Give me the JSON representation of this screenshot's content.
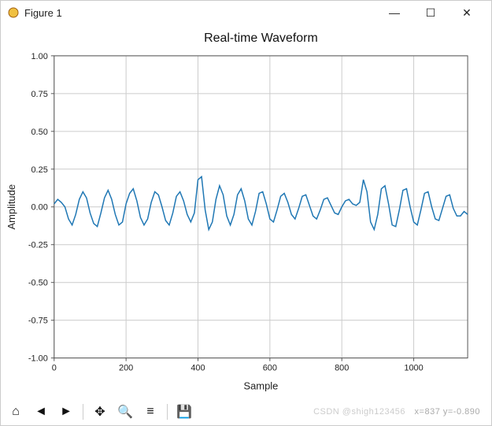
{
  "window": {
    "title": "Figure 1",
    "buttons": {
      "min": "—",
      "max": "☐",
      "close": "✕"
    }
  },
  "chart_data": {
    "type": "line",
    "title": "Real-time Waveform",
    "xlabel": "Sample",
    "ylabel": "Amplitude",
    "xlim": [
      0,
      1150
    ],
    "ylim": [
      -1.0,
      1.0
    ],
    "xticks": [
      0,
      200,
      400,
      600,
      800,
      1000
    ],
    "yticks": [
      -1.0,
      -0.75,
      -0.5,
      -0.25,
      0.0,
      0.25,
      0.5,
      0.75,
      1.0
    ],
    "x_step": 10,
    "values": [
      0.02,
      0.05,
      0.03,
      0.0,
      -0.08,
      -0.12,
      -0.05,
      0.05,
      0.1,
      0.06,
      -0.04,
      -0.11,
      -0.13,
      -0.04,
      0.06,
      0.11,
      0.05,
      -0.05,
      -0.12,
      -0.1,
      0.02,
      0.09,
      0.12,
      0.04,
      -0.07,
      -0.12,
      -0.08,
      0.03,
      0.1,
      0.08,
      0.0,
      -0.09,
      -0.12,
      -0.04,
      0.07,
      0.1,
      0.04,
      -0.05,
      -0.1,
      -0.04,
      0.18,
      0.2,
      -0.02,
      -0.15,
      -0.1,
      0.05,
      0.14,
      0.08,
      -0.06,
      -0.12,
      -0.05,
      0.08,
      0.12,
      0.04,
      -0.08,
      -0.12,
      -0.03,
      0.09,
      0.1,
      0.02,
      -0.08,
      -0.1,
      -0.02,
      0.07,
      0.09,
      0.03,
      -0.05,
      -0.08,
      -0.01,
      0.07,
      0.08,
      0.01,
      -0.06,
      -0.08,
      -0.02,
      0.05,
      0.06,
      0.01,
      -0.04,
      -0.05,
      0.0,
      0.04,
      0.05,
      0.02,
      0.01,
      0.03,
      0.18,
      0.1,
      -0.1,
      -0.15,
      -0.05,
      0.12,
      0.14,
      0.02,
      -0.12,
      -0.13,
      -0.02,
      0.11,
      0.12,
      0.0,
      -0.1,
      -0.12,
      -0.02,
      0.09,
      0.1,
      0.0,
      -0.08,
      -0.09,
      -0.01,
      0.07,
      0.08,
      -0.01,
      -0.06,
      -0.06,
      -0.03,
      -0.05
    ]
  },
  "toolbar": {
    "home": "⌂",
    "back": "◄",
    "forward": "►",
    "pan": "✥",
    "zoom": "🔍",
    "config": "≡",
    "save": "💾",
    "coords": "x=837  y=-0.890"
  },
  "watermark": "CSDN @shigh123456"
}
